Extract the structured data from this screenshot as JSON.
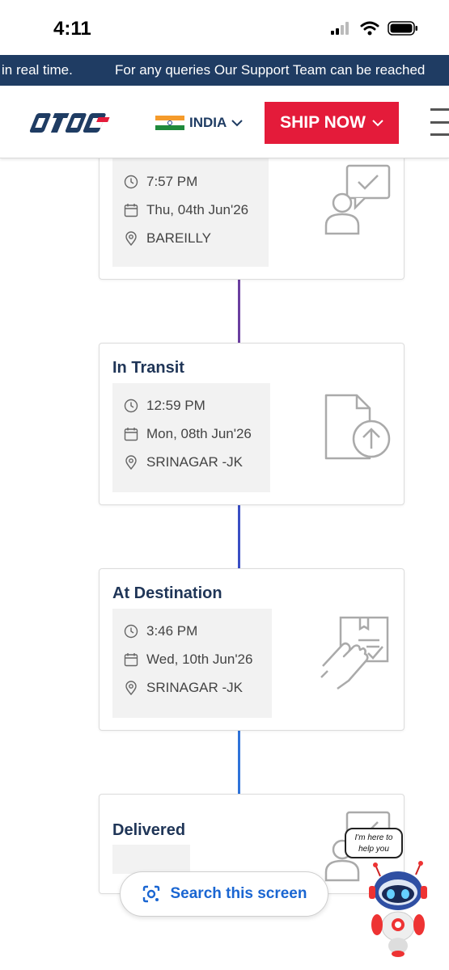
{
  "status_bar": {
    "time": "4:11"
  },
  "marquee": {
    "segment_1": "in real time.",
    "segment_2": "For any queries Our Support Team can be reached"
  },
  "header": {
    "logo_icon": "dtdc-logo",
    "country": "INDIA",
    "ship_button": "SHIP NOW",
    "menu_icon": "hamburger-icon"
  },
  "colors": {
    "navy": "#1f3c63",
    "brand_red": "#e41b3a",
    "connector_1": "#6b3fa0",
    "connector_2": "#3a4fc4",
    "connector_3": "#2f73d9",
    "search_blue": "#1a66d2"
  },
  "timeline": [
    {
      "title": "",
      "time": "7:57 PM",
      "date": "Thu, 04th Jun'26",
      "location": "BAREILLY",
      "icon": "person-chat-check-icon"
    },
    {
      "title": "In Transit",
      "time": "12:59 PM",
      "date": "Mon, 08th Jun'26",
      "location": "SRINAGAR -JK",
      "icon": "document-upload-icon"
    },
    {
      "title": "At Destination",
      "time": "3:46 PM",
      "date": "Wed, 10th Jun'26",
      "location": "SRINAGAR -JK",
      "icon": "hand-package-icon"
    },
    {
      "title": "Delivered",
      "icon": "person-chat-check-icon"
    }
  ],
  "search_pill": {
    "label": "Search this screen",
    "icon": "lens-icon"
  },
  "chatbot": {
    "bubble_line_1": "I'm here to",
    "bubble_line_2": "help you",
    "icon": "robot-icon"
  }
}
